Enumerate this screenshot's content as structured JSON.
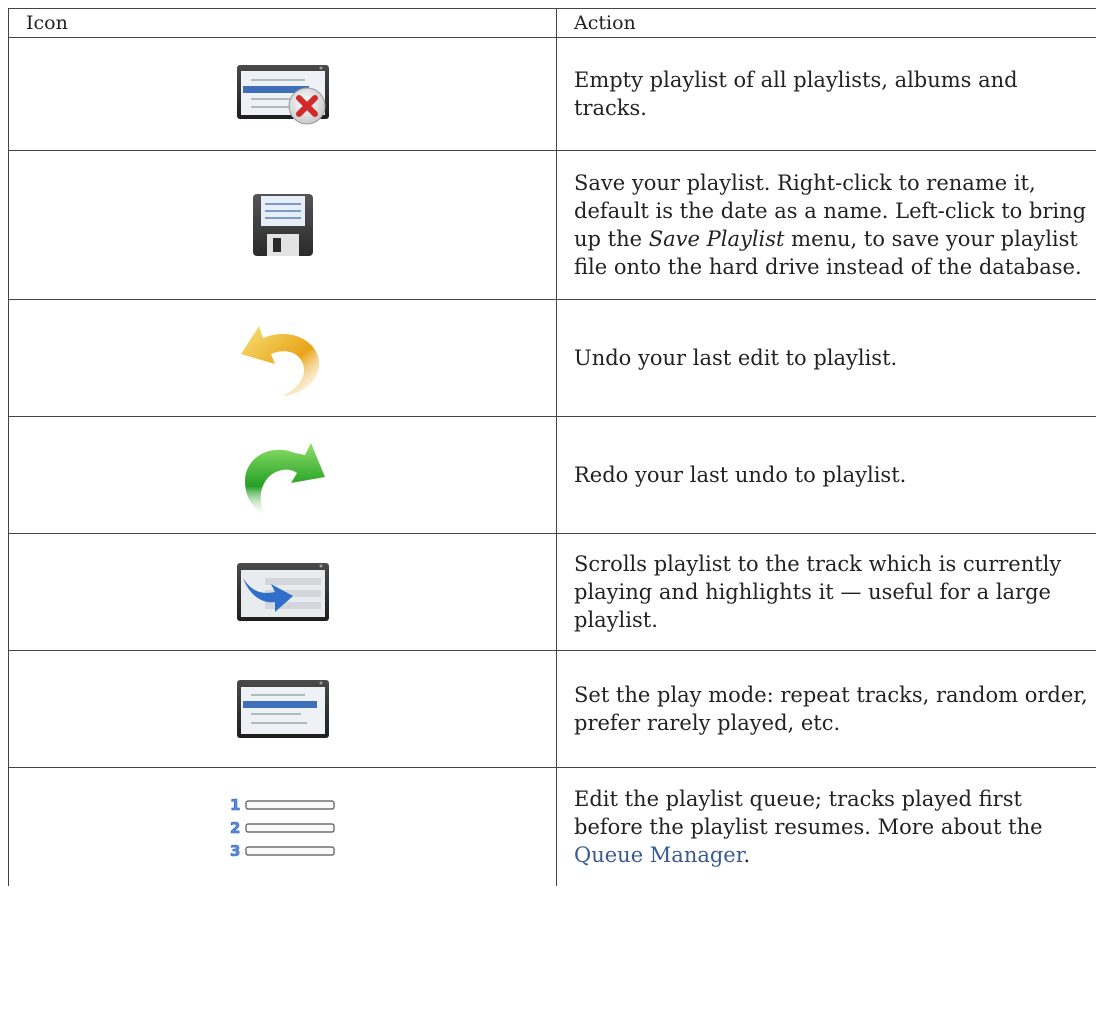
{
  "table": {
    "header": {
      "icon": "Icon",
      "action": "Action"
    },
    "rows": [
      {
        "icon": "clear-playlist-icon",
        "action": "Empty playlist of all playlists, albums and tracks."
      },
      {
        "icon": "save-icon",
        "action_before": "Save your playlist. Right-click to rename it, default is the date as a name. Left-click to bring up the ",
        "action_emphasis": "Save Playlist",
        "action_after": " menu, to save your playlist file onto the hard drive instead of the database."
      },
      {
        "icon": "undo-icon",
        "action": "Undo your last edit to playlist."
      },
      {
        "icon": "redo-icon",
        "action": "Redo your last undo to playlist."
      },
      {
        "icon": "scroll-to-track-icon",
        "action": "Scrolls playlist to the track which is currently playing and highlights it — useful for a large playlist."
      },
      {
        "icon": "play-mode-icon",
        "action": "Set the play mode: repeat tracks, random order, prefer rarely played, etc."
      },
      {
        "icon": "queue-icon",
        "action_before": "Edit the playlist queue; tracks played first before the playlist resumes. More about the ",
        "action_link": "Queue Manager",
        "action_after": "."
      }
    ]
  }
}
